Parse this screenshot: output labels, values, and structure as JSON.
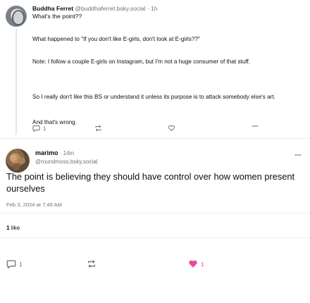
{
  "parent_post": {
    "author_name": "Buddha Ferret",
    "handle": "@buddhaferret.bsky.social",
    "time_sep": " · ",
    "time": "1h",
    "subtitle": "What's the point??",
    "paragraphs": [
      "What happened to \"If you don't like E-girls, don't look at E-girls??\"",
      "Note: I follow a couple E-girls on Instagram, but I'm not a huge consumer of that stuff.",
      "So I really don't like this BS or understand it unless its purpose is to attack somebody else's art.",
      "And that's wrong."
    ],
    "actions": {
      "reply_count": "1",
      "repost_count": "",
      "like_count": ""
    }
  },
  "main_post": {
    "author_name": "marimo",
    "time_sep": " · ",
    "time": "14m",
    "handle": "@roundmoss.bsky.social",
    "text": "The point is believing they should have control over how women present ourselves",
    "date": "Feb 3, 2024 at 7:49 AM",
    "likes_count": "1",
    "likes_label": "like",
    "actions": {
      "reply_count": "1",
      "repost_count": "",
      "like_count": "1"
    }
  },
  "colors": {
    "like_active": "#ec4899",
    "muted": "#6b7480"
  },
  "icons": {
    "reply": "speech-bubble-icon",
    "repost": "repost-icon",
    "like": "heart-icon",
    "more": "ellipsis-icon"
  }
}
